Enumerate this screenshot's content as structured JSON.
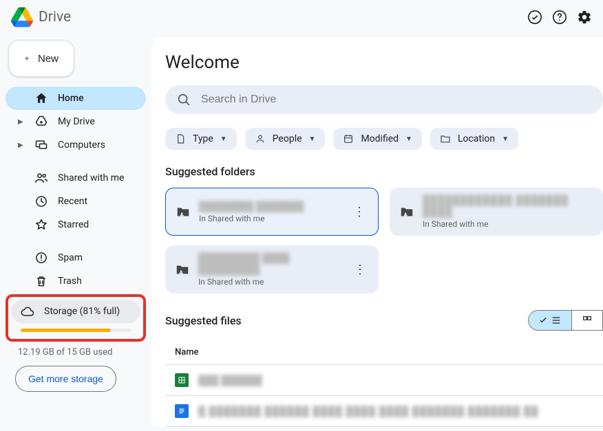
{
  "app": {
    "title": "Drive"
  },
  "header": {
    "new_label": "New"
  },
  "sidebar": {
    "items": [
      {
        "label": "Home",
        "icon": "home",
        "active": true
      },
      {
        "label": "My Drive",
        "icon": "drive",
        "expandable": true
      },
      {
        "label": "Computers",
        "icon": "computers",
        "expandable": true
      },
      {
        "label": "Shared with me",
        "icon": "shared"
      },
      {
        "label": "Recent",
        "icon": "recent"
      },
      {
        "label": "Starred",
        "icon": "star"
      },
      {
        "label": "Spam",
        "icon": "spam"
      },
      {
        "label": "Trash",
        "icon": "trash"
      }
    ],
    "storage": {
      "label": "Storage (81% full)",
      "percent": 81,
      "used_text": "12.19 GB of 15 GB used",
      "get_more": "Get more storage"
    }
  },
  "main": {
    "title": "Welcome",
    "search_placeholder": "Search in Drive",
    "filters": [
      {
        "label": "Type",
        "icon": "file"
      },
      {
        "label": "People",
        "icon": "person"
      },
      {
        "label": "Modified",
        "icon": "calendar"
      },
      {
        "label": "Location",
        "icon": "folder"
      }
    ],
    "suggested_folders_h": "Suggested folders",
    "folders": [
      {
        "title": "████████ ███████",
        "sub": "In Shared with me",
        "selected": true
      },
      {
        "title": "████████████ ███████ ████",
        "sub": "In Shared with me"
      },
      {
        "title": "█████████ ████ █████████",
        "sub": "In Shared with me"
      }
    ],
    "suggested_files_h": "Suggested files",
    "col_name": "Name",
    "files": [
      {
        "type": "sheets",
        "name": "███ ██████"
      },
      {
        "type": "docs",
        "name": "█ ███████ ██████ ████ ████ ████ ███████ ███████ ██"
      }
    ]
  }
}
